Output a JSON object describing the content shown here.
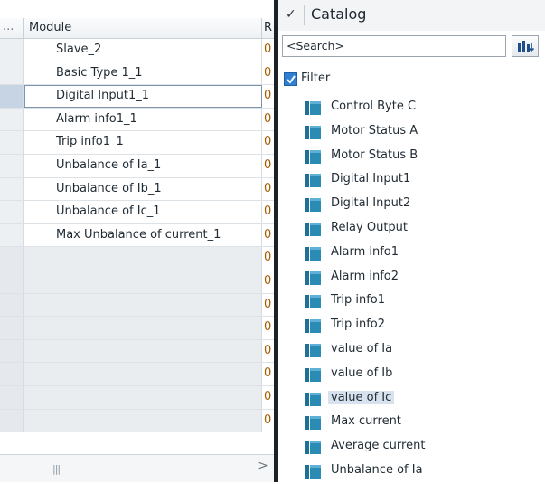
{
  "left_table": {
    "headers": {
      "ellipsis": "...",
      "module": "Module",
      "third": "R"
    },
    "rows": [
      {
        "module": "Slave_2",
        "r": "0"
      },
      {
        "module": "Basic Type 1_1",
        "r": "0"
      },
      {
        "module": "Digital Input1_1",
        "r": "0"
      },
      {
        "module": "Alarm info1_1",
        "r": "0"
      },
      {
        "module": "Trip info1_1",
        "r": "0"
      },
      {
        "module": "Unbalance of Ia_1",
        "r": "0"
      },
      {
        "module": "Unbalance of Ib_1",
        "r": "0"
      },
      {
        "module": "Unbalance of Ic_1",
        "r": "0"
      },
      {
        "module": "Max Unbalance of current_1",
        "r": "0"
      },
      {
        "module": "",
        "r": "0"
      },
      {
        "module": "",
        "r": "0"
      },
      {
        "module": "",
        "r": "0"
      },
      {
        "module": "",
        "r": "0"
      },
      {
        "module": "",
        "r": "0"
      },
      {
        "module": "",
        "r": "0"
      },
      {
        "module": "",
        "r": "0"
      },
      {
        "module": "",
        "r": "0"
      }
    ],
    "scroll_grip": "|||",
    "scroll_right_arrow": ">"
  },
  "catalog": {
    "title": "Catalog",
    "collapse_icon": "chevron-down-icon",
    "search_placeholder": "<Search>",
    "search_button_icon": "search-catalog-icon",
    "filter_label": "Filter",
    "filter_checked": true,
    "icon_color": "#2a8bb5",
    "items": [
      "Control Byte C",
      "Motor Status A",
      "Motor Status B",
      "Digital Input1",
      "Digital Input2",
      "Relay Output",
      "Alarm info1",
      "Alarm info2",
      "Trip info1",
      "Trip info2",
      "value of Ia",
      "value of Ib",
      "value of Ic",
      "Max current",
      "Average current",
      "Unbalance of Ia"
    ]
  }
}
